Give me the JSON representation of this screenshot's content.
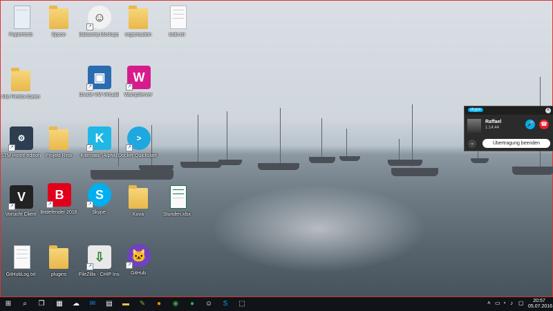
{
  "desktop": {
    "icons": [
      {
        "label": "Papierkorb"
      },
      {
        "label": "Epson"
      },
      {
        "label": "Balsamiq Mockups 3"
      },
      {
        "label": "organisation"
      },
      {
        "label": "todo.txt"
      },
      {
        "label": "Alte Firefox-Daten"
      },
      {
        "label": "Oracle VM VirtualBox"
      },
      {
        "label": "WampServer"
      },
      {
        "label": "STM Home edition"
      },
      {
        "label": "Projekt Redi"
      },
      {
        "label": "Kitematic (Alpha)"
      },
      {
        "label": "Docker Quickstart Terminal"
      },
      {
        "label": "Vorsicht Client"
      },
      {
        "label": "Bitdefender 2016"
      },
      {
        "label": "Skype"
      },
      {
        "label": "Kova"
      },
      {
        "label": "Stunden.xlsx"
      },
      {
        "label": "GitHubLog.txt"
      },
      {
        "label": "plugins"
      },
      {
        "label": "FileZilla - CHIP Installer"
      },
      {
        "label": "GitHub"
      }
    ]
  },
  "skype_call": {
    "brand": "skype",
    "caller_name": "Raffael",
    "duration": "1:14:44",
    "end_share_button": "Übertragung beenden",
    "colors": {
      "accent": "#00aff0",
      "hangup": "#e8212c"
    }
  },
  "taskbar": {
    "clock_time": "20:57",
    "clock_date": "05.07.2016",
    "tray_language": "ENG"
  }
}
